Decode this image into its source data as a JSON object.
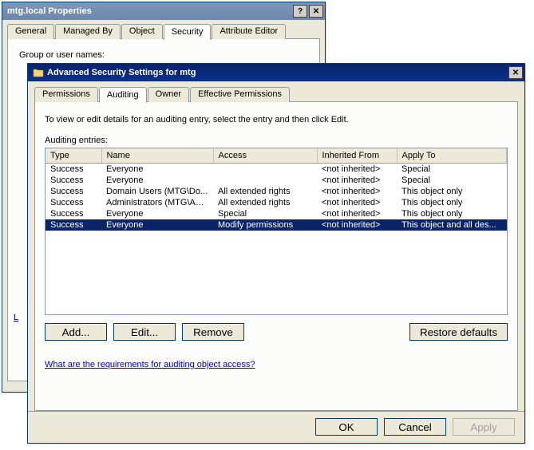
{
  "parent": {
    "title": "mtg.local Properties",
    "tabs": [
      "General",
      "Managed By",
      "Object",
      "Security",
      "Attribute Editor"
    ],
    "active_tab": 3,
    "group_label": "Group or user names:",
    "link": "L"
  },
  "child": {
    "title": "Advanced Security Settings for mtg",
    "tabs": [
      "Permissions",
      "Auditing",
      "Owner",
      "Effective Permissions"
    ],
    "active_tab": 1,
    "instruction": "To view or edit details for an auditing entry, select the entry and then click Edit.",
    "list_label": "Auditing entries:",
    "columns": [
      "Type",
      "Name",
      "Access",
      "Inherited From",
      "Apply To"
    ],
    "rows": [
      {
        "type": "Success",
        "name": "Everyone",
        "access": "",
        "inh": "<not inherited>",
        "apply": "Special"
      },
      {
        "type": "Success",
        "name": "Everyone",
        "access": "",
        "inh": "<not inherited>",
        "apply": "Special"
      },
      {
        "type": "Success",
        "name": "Domain Users (MTG\\Do...",
        "access": "All extended rights",
        "inh": "<not inherited>",
        "apply": "This object only"
      },
      {
        "type": "Success",
        "name": "Administrators (MTG\\Adm...",
        "access": "All extended rights",
        "inh": "<not inherited>",
        "apply": "This object only"
      },
      {
        "type": "Success",
        "name": "Everyone",
        "access": "Special",
        "inh": "<not inherited>",
        "apply": "This object only"
      },
      {
        "type": "Success",
        "name": "Everyone",
        "access": "Modify permissions",
        "inh": "<not inherited>",
        "apply": "This object and all des..."
      }
    ],
    "selected_row": 5,
    "buttons": {
      "add": "Add...",
      "edit": "Edit...",
      "remove": "Remove",
      "restore": "Restore defaults"
    },
    "help_link": "What are the requirements for auditing object access?",
    "bottom": {
      "ok": "OK",
      "cancel": "Cancel",
      "apply": "Apply"
    }
  }
}
